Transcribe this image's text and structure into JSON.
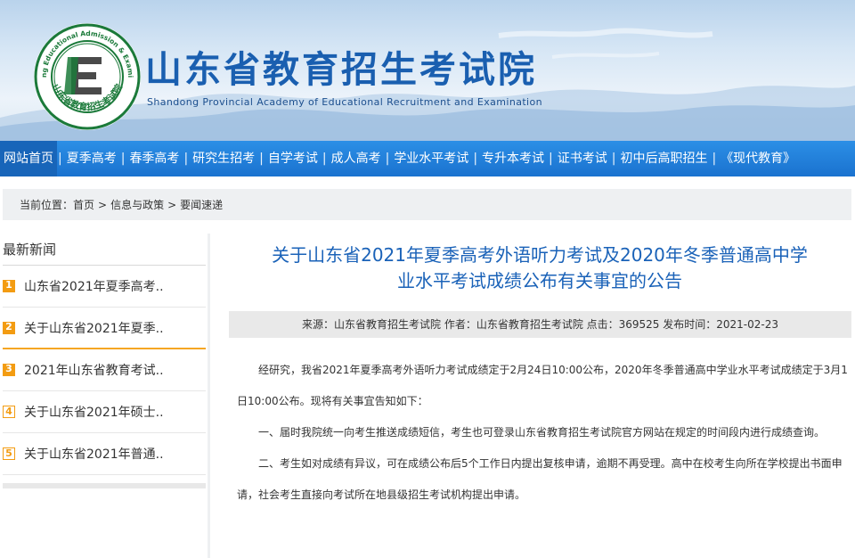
{
  "header": {
    "title": "山东省教育招生考试院",
    "subtitle": "Shandong Provincial Academy of Educational Recruitment and Examination",
    "logo": {
      "ring_text": "Shandong Educational Admission & Examinations",
      "bottom_text": "山东省教育招生考试院",
      "letter": "E",
      "ring_color": "#1b7a3a"
    }
  },
  "nav": {
    "items": [
      "网站首页",
      "夏季高考",
      "春季高考",
      "研究生招考",
      "自学考试",
      "成人高考",
      "学业水平考试",
      "专升本考试",
      "证书考试",
      "初中后高职招生",
      "《现代教育》"
    ],
    "separator": "|",
    "active_index": 0
  },
  "breadcrumb": {
    "prefix": "当前位置：",
    "items": [
      "首页",
      "信息与政策",
      "要闻速递"
    ],
    "separator": ">"
  },
  "sidebar": {
    "title": "最新新闻",
    "items": [
      {
        "num": "1",
        "label": "山东省2021年夏季高考.."
      },
      {
        "num": "2",
        "label": "关于山东省2021年夏季.."
      },
      {
        "num": "3",
        "label": "2021年山东省教育考试.."
      },
      {
        "num": "4",
        "label": "关于山东省2021年硕士.."
      },
      {
        "num": "5",
        "label": "关于山东省2021年普通.."
      }
    ]
  },
  "article": {
    "title_line1": "关于山东省2021年夏季高考外语听力考试及2020年冬季普通高中学",
    "title_line2": "业水平考试成绩公布有关事宜的公告",
    "meta": "来源：山东省教育招生考试院 作者：山东省教育招生考试院 点击：369525 发布时间：2021-02-23",
    "paragraphs": [
      "经研究，我省2021年夏季高考外语听力考试成绩定于2月24日10:00公布，2020年冬季普通高中学业水平考试成绩定于3月1日10:00公布。现将有关事宜告知如下：",
      "一、届时我院统一向考生推送成绩短信，考生也可登录山东省教育招生考试院官方网站在规定的时间段内进行成绩查询。",
      "二、考生如对成绩有异议，可在成绩公布后5个工作日内提出复核申请，逾期不再受理。高中在校考生向所在学校提出书面申请，社会考生直接向考试所在地县级招生考试机构提出申请。"
    ]
  },
  "colors": {
    "nav_bg": "#1a72cf",
    "title_blue": "#1a62b8",
    "accent_orange": "#f39c12"
  }
}
